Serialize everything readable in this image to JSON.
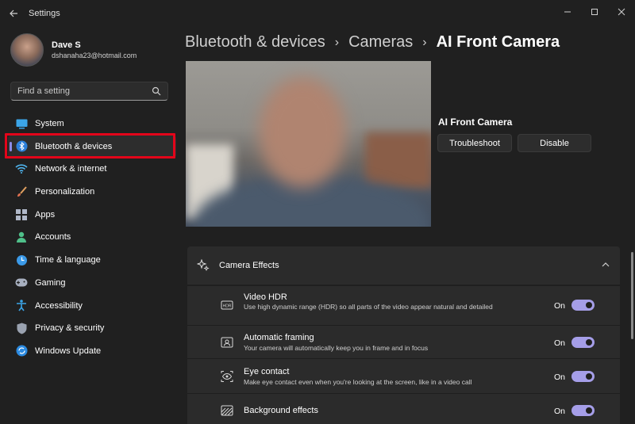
{
  "window": {
    "title": "Settings"
  },
  "profile": {
    "name": "Dave S",
    "email": "dshanaha23@hotmail.com"
  },
  "search": {
    "placeholder": "Find a setting"
  },
  "nav": [
    {
      "label": "System",
      "icon": "monitor-icon",
      "active": false
    },
    {
      "label": "Bluetooth & devices",
      "icon": "bluetooth-icon",
      "active": true
    },
    {
      "label": "Network & internet",
      "icon": "wifi-icon",
      "active": false
    },
    {
      "label": "Personalization",
      "icon": "brush-icon",
      "active": false
    },
    {
      "label": "Apps",
      "icon": "apps-icon",
      "active": false
    },
    {
      "label": "Accounts",
      "icon": "person-icon",
      "active": false
    },
    {
      "label": "Time & language",
      "icon": "globe-clock-icon",
      "active": false
    },
    {
      "label": "Gaming",
      "icon": "gamepad-icon",
      "active": false
    },
    {
      "label": "Accessibility",
      "icon": "accessibility-icon",
      "active": false
    },
    {
      "label": "Privacy & security",
      "icon": "shield-icon",
      "active": false
    },
    {
      "label": "Windows Update",
      "icon": "update-icon",
      "active": false
    }
  ],
  "breadcrumb": [
    "Bluetooth & devices",
    "Cameras",
    "AI Front Camera"
  ],
  "camera": {
    "name": "AI Front Camera",
    "troubleshoot_label": "Troubleshoot",
    "disable_label": "Disable"
  },
  "effects": {
    "title": "Camera Effects",
    "items": [
      {
        "title": "Video HDR",
        "description": "Use high dynamic range (HDR) so all parts of the video appear natural and detailed",
        "state": "On",
        "icon": "hdr-icon"
      },
      {
        "title": "Automatic framing",
        "description": "Your camera will automatically keep you in frame and in focus",
        "state": "On",
        "icon": "framing-icon"
      },
      {
        "title": "Eye contact",
        "description": "Make eye contact even when you're looking at the screen, like in a video call",
        "state": "On",
        "icon": "eye-contact-icon"
      },
      {
        "title": "Background effects",
        "description": "",
        "state": "On",
        "icon": "background-effects-icon"
      }
    ]
  },
  "colors": {
    "accent": "#a59ee8",
    "highlight": "#e3051a",
    "background": "#202020",
    "card": "#2b2b2b"
  }
}
